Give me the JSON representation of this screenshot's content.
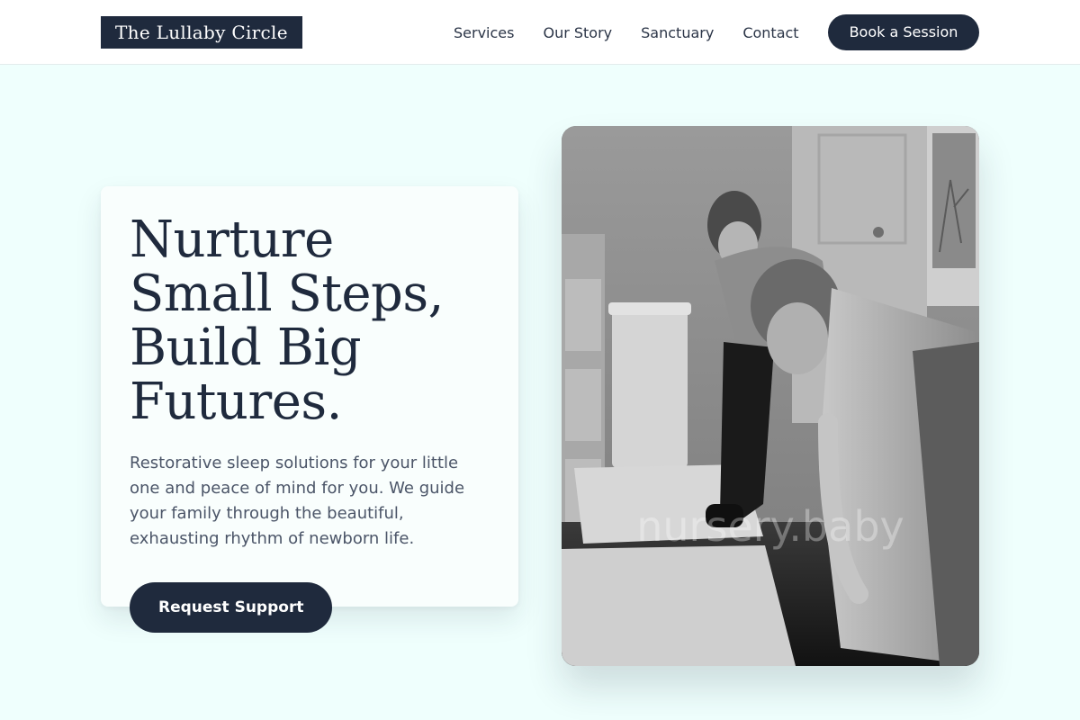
{
  "header": {
    "logo": "The Lullaby Circle",
    "nav": [
      {
        "label": "Services"
      },
      {
        "label": "Our Story"
      },
      {
        "label": "Sanctuary"
      },
      {
        "label": "Contact"
      }
    ],
    "cta_label": "Book a Session"
  },
  "hero": {
    "title": "Nurture Small Steps, Build Big Futures.",
    "subtitle": "Restorative sleep solutions for your little one and peace of mind for you. We guide your family through the beautiful, exhausting rhythm of newborn life.",
    "button_label": "Request Support"
  },
  "photo": {
    "watermark": "nursery.baby",
    "description_icon": "photo-doula-supporting-mother"
  },
  "colors": {
    "background": "#effffd",
    "primary": "#1f2a3d",
    "card": "#f9fefd"
  }
}
